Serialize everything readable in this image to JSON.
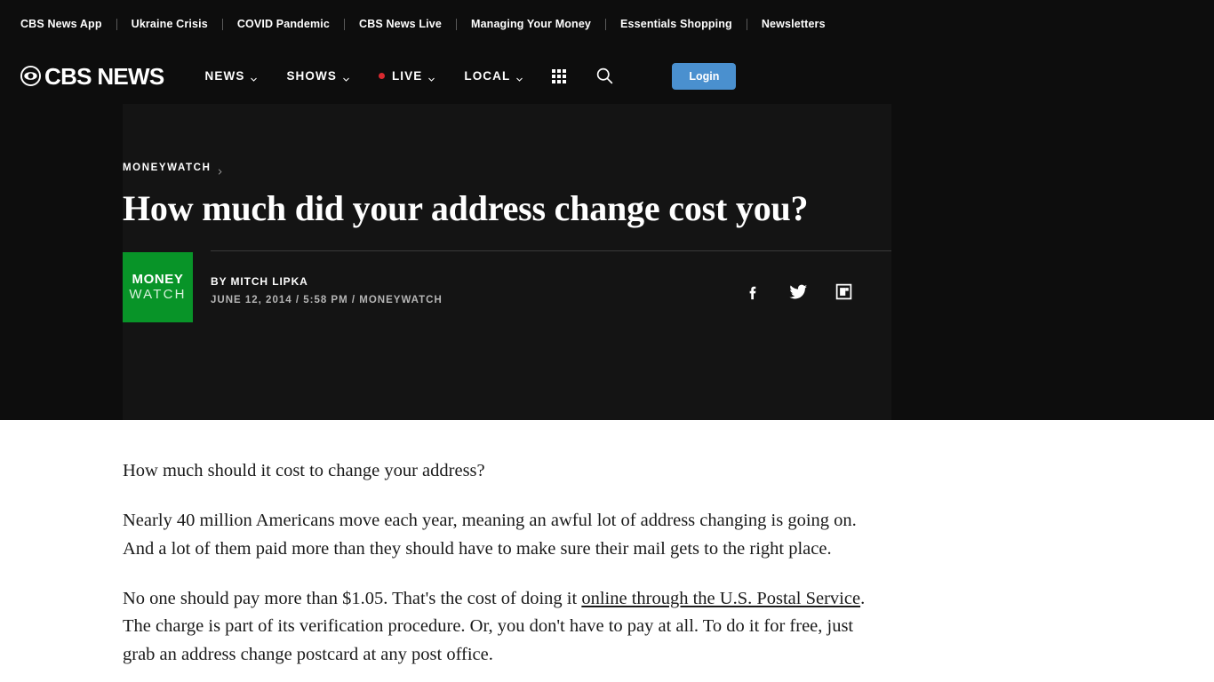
{
  "utility_nav": {
    "items": [
      {
        "label": "CBS News App"
      },
      {
        "label": "Ukraine Crisis"
      },
      {
        "label": "COVID Pandemic"
      },
      {
        "label": "CBS News Live"
      },
      {
        "label": "Managing Your Money"
      },
      {
        "label": "Essentials Shopping"
      },
      {
        "label": "Newsletters"
      }
    ]
  },
  "main_nav": {
    "brand": "CBS NEWS",
    "brand_icon": "cbs-eye-icon",
    "items": [
      {
        "label": "NEWS",
        "has_dropdown": true,
        "live": false
      },
      {
        "label": "SHOWS",
        "has_dropdown": true,
        "live": false
      },
      {
        "label": "LIVE",
        "has_dropdown": true,
        "live": true
      },
      {
        "label": "LOCAL",
        "has_dropdown": true,
        "live": false
      }
    ],
    "grid_icon": "apps-grid-icon",
    "search_icon": "search-icon",
    "login_label": "Login",
    "login_color": "#4a90cf",
    "live_dot_color": "#d8292f"
  },
  "article": {
    "breadcrumb": "MONEYWATCH",
    "breadcrumb_chevron": "chevron-right-icon",
    "headline": "How much did your address change cost you?",
    "badge": {
      "line1": "MONEY",
      "line2": "WATCH",
      "color": "#089428"
    },
    "byline": "BY MITCH LIPKA",
    "dateline": "JUNE 12, 2014 / 5:58 PM / MONEYWATCH",
    "share": [
      {
        "name": "facebook-share-icon"
      },
      {
        "name": "twitter-share-icon"
      },
      {
        "name": "flipboard-share-icon"
      }
    ],
    "paragraphs": [
      {
        "before": "How much should it cost to change your address?",
        "link": "",
        "after": ""
      },
      {
        "before": "Nearly 40 million Americans move each year, meaning an awful lot of address changing is going on. And a lot of them paid more than they should have to make sure their mail gets to the right place.",
        "link": "",
        "after": ""
      },
      {
        "before": "No one should pay more than $1.05. That's the cost of doing it ",
        "link": "online through the U.S. Postal Service",
        "after": ". The charge is part of its verification procedure. Or, you don't have to pay at all. To do it for free, just grab an address change postcard at any post office."
      }
    ]
  }
}
